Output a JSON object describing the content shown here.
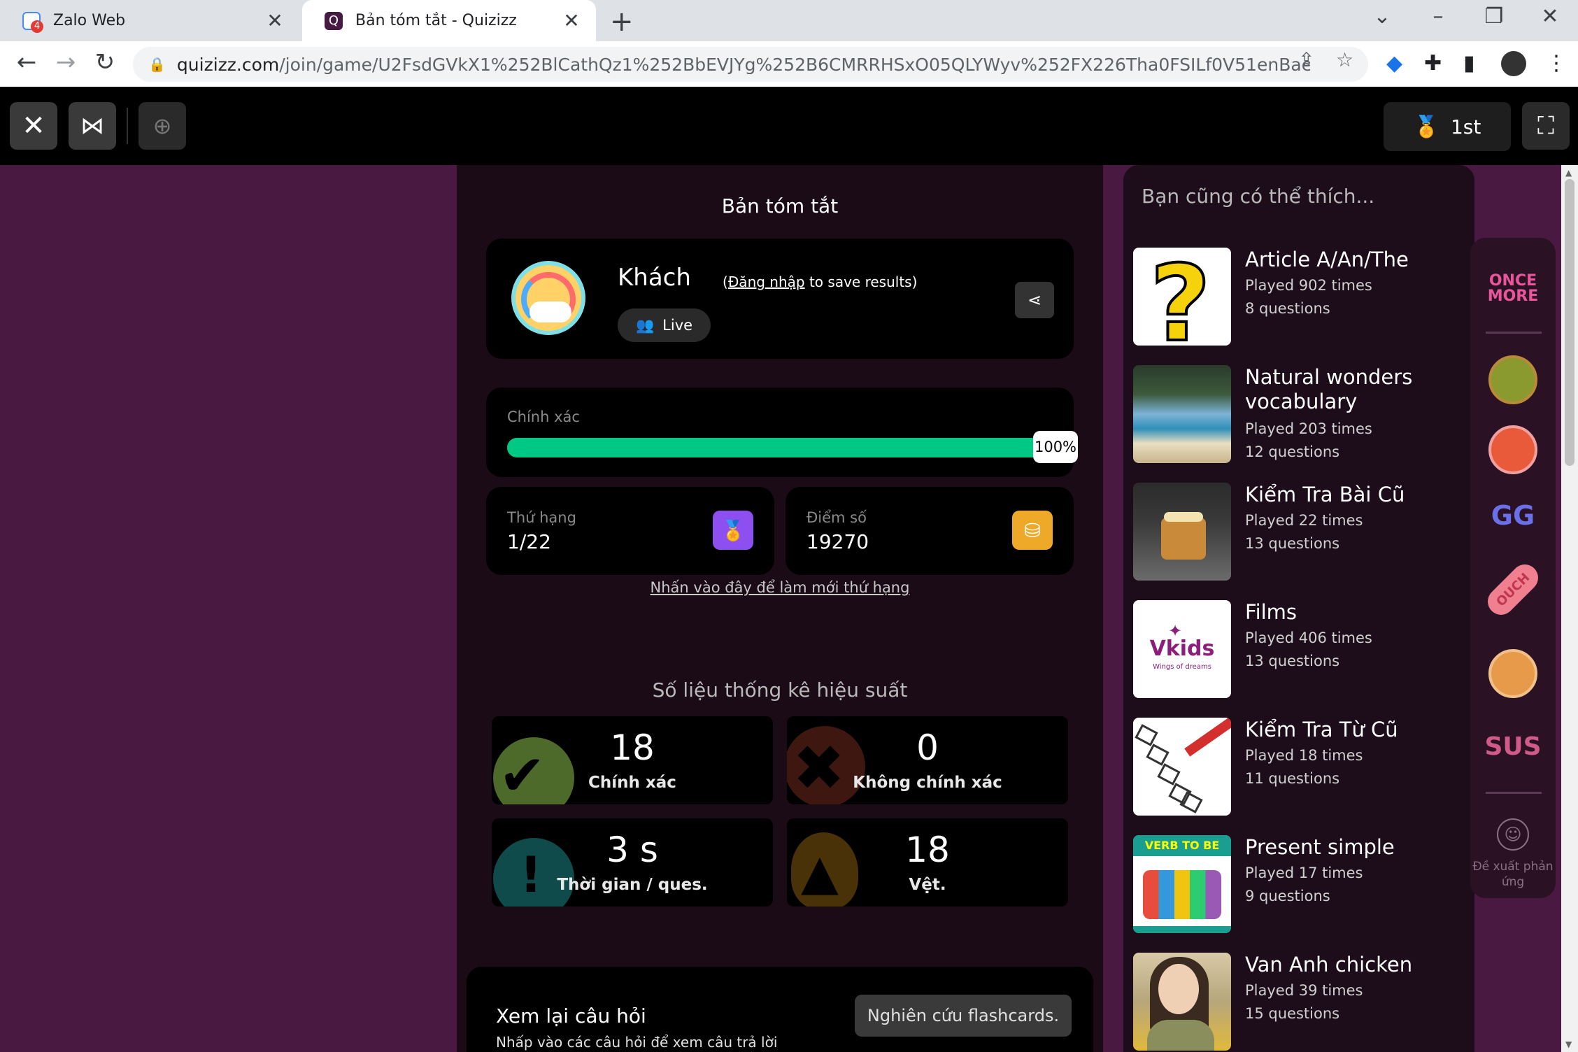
{
  "browser": {
    "tabs": [
      {
        "title": "Zalo Web",
        "badge": "4",
        "icon": "zalo-icon"
      },
      {
        "title": "Bản tóm tắt - Quizizz",
        "icon": "quizizz-icon"
      }
    ],
    "url_host": "quizizz.com",
    "url_path": "/join/game/U2FsdGVkX1%252BlCathQz1%252BbEVJYg%252B6CMRRHSxO05QLYWyv%252FX226Tha0FSILf0V51enBaebSVlk77ssG%25..."
  },
  "header": {
    "rank_label": "1st"
  },
  "summary": {
    "title": "Bản tóm tắt",
    "player_name": "Khách",
    "login_link": "Đăng nhập",
    "save_text": " to save results)",
    "open_paren": "(",
    "mode_label": "Live",
    "accuracy_label": "Chính xác",
    "accuracy_value": "100%",
    "accuracy_fraction": 1.0,
    "rank_label": "Thứ hạng",
    "rank_value": "1/22",
    "score_label": "Điểm số",
    "score_value": "19270",
    "refresh_link": "Nhấn vào đây để làm mới thứ hạng",
    "perf_title": "Số liệu thống kê hiệu suất",
    "correct_value": "18",
    "correct_label": "Chính xác",
    "incorrect_value": "0",
    "incorrect_label": "Không chính xác",
    "time_value": "3 s",
    "time_label": "Thời gian / ques.",
    "streak_value": "18",
    "streak_label": "Vệt.",
    "review_title": "Xem lại câu hỏi",
    "review_subtitle": "Nhấp vào các câu hỏi để xem câu trả lời",
    "flashcards_button": "Nghiên cứu flashcards."
  },
  "recommendations": {
    "title": "Bạn cũng có thể thích...",
    "items": [
      {
        "title": "Article A/An/The",
        "played": "Played 902 times",
        "questions": "8 questions"
      },
      {
        "title": "Natural wonders vocabulary",
        "played": "Played 203 times",
        "questions": "12 questions"
      },
      {
        "title": "Kiểm Tra Bài Cũ",
        "played": "Played 22 times",
        "questions": "13 questions"
      },
      {
        "title": "Films",
        "played": "Played 406 times",
        "questions": "13 questions",
        "thumb_logo": "Vkids",
        "thumb_tagline": "Wings of dreams"
      },
      {
        "title": "Kiểm Tra Từ Cũ",
        "played": "Played 18 times",
        "questions": "11 questions"
      },
      {
        "title": "Present simple",
        "played": "Played 17 times",
        "questions": "9 questions",
        "thumb_header": "VERB TO BE"
      },
      {
        "title": "Van Anh chicken",
        "played": "Played 39 times",
        "questions": "15 questions"
      }
    ]
  },
  "reactions": {
    "items": [
      "ONCE MORE",
      "OUCH",
      "SUS",
      "GG"
    ],
    "suggest_label": "Đề xuất phản ứng"
  },
  "colors": {
    "page_bg": "#4a1942",
    "accent_green": "#00c985",
    "medal_purple": "#8d4ff0",
    "coin_orange": "#efa929"
  }
}
